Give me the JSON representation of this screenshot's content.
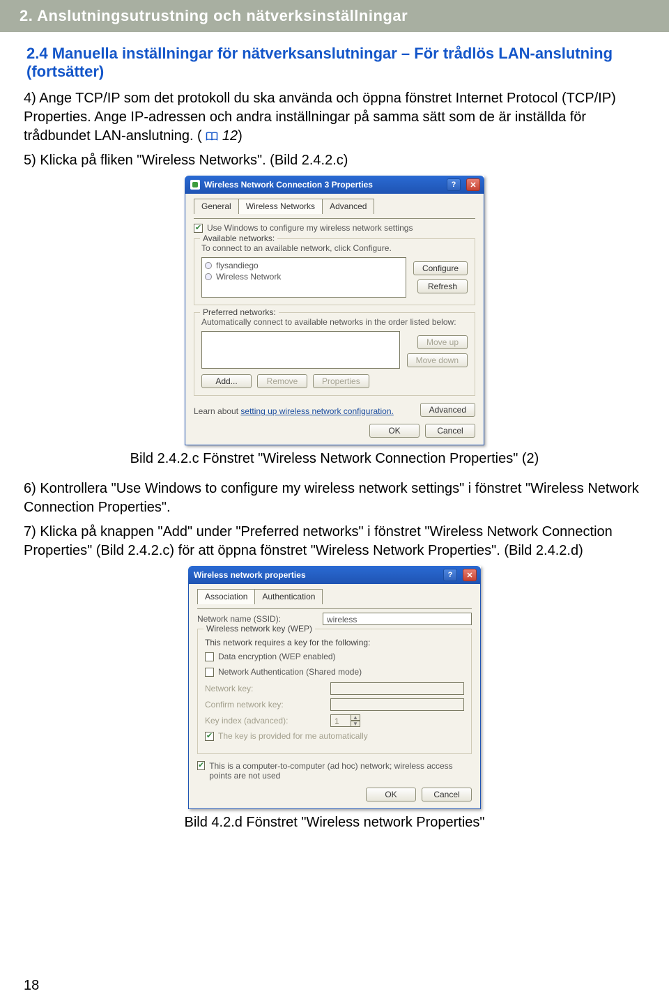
{
  "header": "2. Anslutningsutrustning och nätverksinställningar",
  "subhead": "2.4 Manuella inställningar för nätverksanslutningar – För trådlös LAN-anslutning (fortsätter)",
  "step4": "4) Ange TCP/IP som det protokoll du ska använda och öppna fönstret Internet Protocol (TCP/IP) Properties. Ange IP-adressen och andra inställningar på samma sätt som de är inställda för trådbundet LAN-anslutning. (",
  "step4_ref": "12",
  "step4_close": ")",
  "step5": "5) Klicka på fliken \"Wireless Networks\". (Bild 2.4.2.c)",
  "caption1": "Bild 2.4.2.c Fönstret \"Wireless Network Connection Properties\" (2)",
  "step6": "6) Kontrollera \"Use Windows to configure my wireless network settings\" i fönstret \"Wireless Network Connection Properties\".",
  "step7": "7) Klicka på knappen \"Add\" under \"Preferred networks\" i fönstret \"Wireless Network Connection Properties\" (Bild 2.4.2.c) för att öppna fönstret \"Wireless Network Properties\". (Bild 2.4.2.d)",
  "caption2": "Bild 4.2.d Fönstret \"Wireless network Properties\"",
  "page_number": "18",
  "dialog1": {
    "title": "Wireless Network Connection 3 Properties",
    "tabs": [
      "General",
      "Wireless Networks",
      "Advanced"
    ],
    "active_tab": 1,
    "use_windows": "Use Windows to configure my wireless network settings",
    "available": {
      "legend": "Available networks:",
      "instruction": "To connect to an available network, click Configure.",
      "items": [
        "flysandiego",
        "Wireless Network"
      ],
      "btn_configure": "Configure",
      "btn_refresh": "Refresh"
    },
    "preferred": {
      "legend": "Preferred networks:",
      "instruction": "Automatically connect to available networks in the order listed below:",
      "btn_moveup": "Move up",
      "btn_movedown": "Move down",
      "btn_add": "Add...",
      "btn_remove": "Remove",
      "btn_properties": "Properties"
    },
    "learn_prefix": "Learn about ",
    "learn_link": "setting up wireless network configuration.",
    "btn_advanced": "Advanced",
    "btn_ok": "OK",
    "btn_cancel": "Cancel"
  },
  "dialog2": {
    "title": "Wireless network properties",
    "tabs": [
      "Association",
      "Authentication"
    ],
    "active_tab": 0,
    "lbl_ssid": "Network name (SSID):",
    "val_ssid": "wireless",
    "lbl_wep": "Wireless network key (WEP)",
    "wep_instr": "This network requires a key for the following:",
    "chk_data_enc": "Data encryption (WEP enabled)",
    "chk_net_auth": "Network Authentication (Shared mode)",
    "lbl_key": "Network key:",
    "lbl_confirm": "Confirm network key:",
    "lbl_keyindex": "Key index (advanced):",
    "val_keyindex": "1",
    "chk_autokey": "The key is provided for me automatically",
    "chk_adhoc": "This is a computer-to-computer (ad hoc) network; wireless access points are not used",
    "btn_ok": "OK",
    "btn_cancel": "Cancel"
  }
}
